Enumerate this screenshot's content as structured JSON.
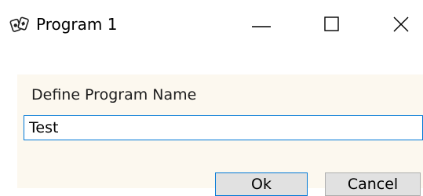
{
  "window": {
    "title": "Program 1",
    "app_icon": "cards-icon",
    "controls": [
      "minimize-icon",
      "maximize-icon",
      "close-icon"
    ]
  },
  "dialog": {
    "prompt": "Define Program Name",
    "name_value": "Test",
    "ok_label": "Ok",
    "cancel_label": "Cancel"
  },
  "colors": {
    "accent": "#0078d7",
    "panel_background": "#fcf8ef",
    "button_face": "#e1e1e1"
  }
}
